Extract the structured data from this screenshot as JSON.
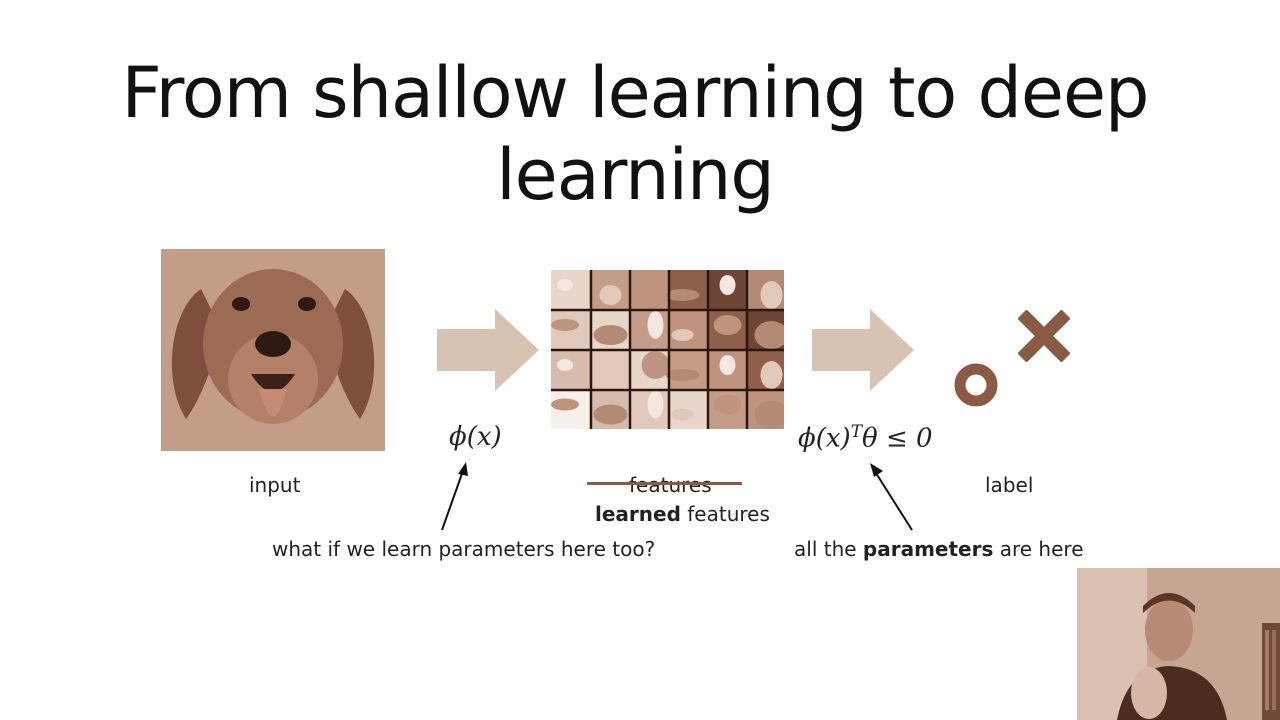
{
  "title": "From shallow learning to deep learning",
  "labels": {
    "input": "input",
    "features_struck": "features",
    "learned_bold": "learned",
    "learned_rest": " features",
    "label": "label"
  },
  "math": {
    "phi": "ϕ(x)",
    "decision_base": "ϕ(x)",
    "decision_sup": "T",
    "decision_rest": "θ ≤ 0"
  },
  "annotations": {
    "left": "what if we learn parameters here too?",
    "right_pre": "all the ",
    "right_bold": "parameters",
    "right_post": " are here"
  },
  "colors": {
    "accent": "#8b5a45",
    "arrow_fill": "#d8c3b3",
    "tint": "#a97b63"
  },
  "icons": [
    "circle-o-icon",
    "cross-x-icon"
  ]
}
